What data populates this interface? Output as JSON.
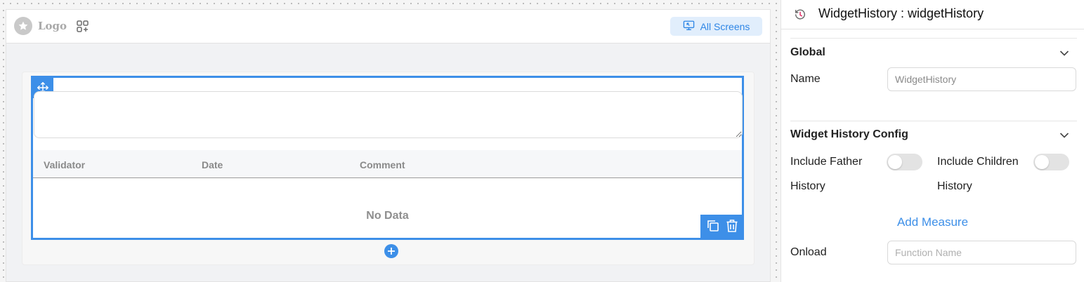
{
  "canvas": {
    "logo_text": "Logo",
    "all_screens_label": "All Screens"
  },
  "widget": {
    "table": {
      "columns": [
        "Validator",
        "Date",
        "Comment"
      ],
      "empty_text": "No Data"
    }
  },
  "panel": {
    "title": "WidgetHistory : widgetHistory",
    "global": {
      "title": "Global",
      "name_label": "Name",
      "name_value": "WidgetHistory"
    },
    "config": {
      "title": "Widget History Config",
      "include_father_label": "Include Father",
      "include_father_label_2": "History",
      "include_children_label": "Include Children",
      "include_children_label_2": "History",
      "include_father_on": false,
      "include_children_on": false,
      "add_measure_label": "Add Measure",
      "onload_label": "Onload",
      "onload_placeholder": "Function Name"
    }
  },
  "colors": {
    "accent": "#3d8fe8",
    "accent_light": "#e1eefc",
    "toggle_off": "#e3e3e3"
  }
}
